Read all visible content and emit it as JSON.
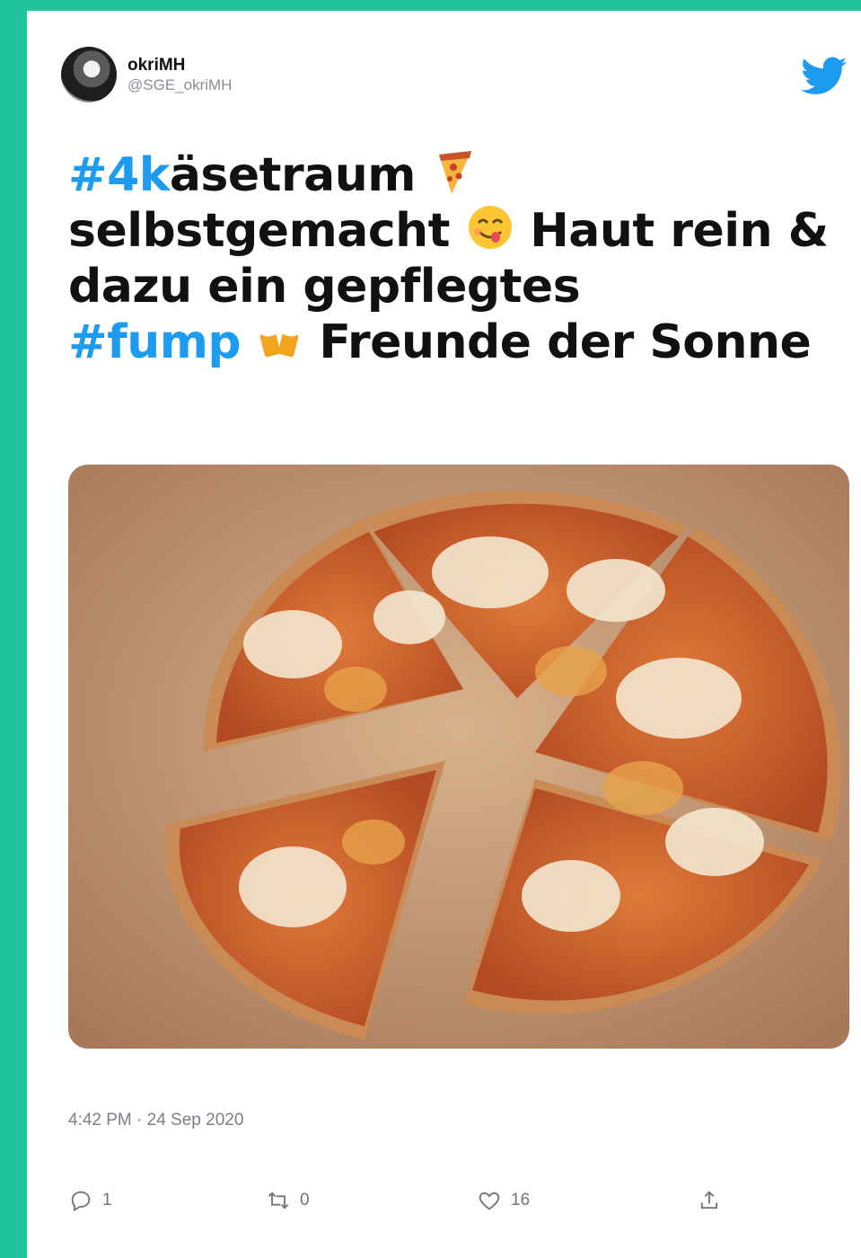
{
  "author": {
    "display_name": "okriMH",
    "handle": "@SGE_okriMH"
  },
  "tweet": {
    "hashtag1": "#4k",
    "text1": "äsetraum",
    "text2": "selbstgemacht",
    "text3": "Haut rein & dazu ein gepflegtes",
    "hashtag2": "#fump",
    "text4": "Freunde der Sonne"
  },
  "emojis": [
    "pizza-emoji",
    "yum-face-emoji",
    "beer-mugs-emoji"
  ],
  "media": {
    "description": "photo of pizza"
  },
  "timestamp": "4:42 PM · 24 Sep 2020",
  "actions": {
    "reply_count": "1",
    "retweet_count": "0",
    "like_count": "16"
  },
  "colors": {
    "background": "#20c49c",
    "hashtag": "#1d9bf0",
    "twitter_blue": "#1d9bf0"
  }
}
